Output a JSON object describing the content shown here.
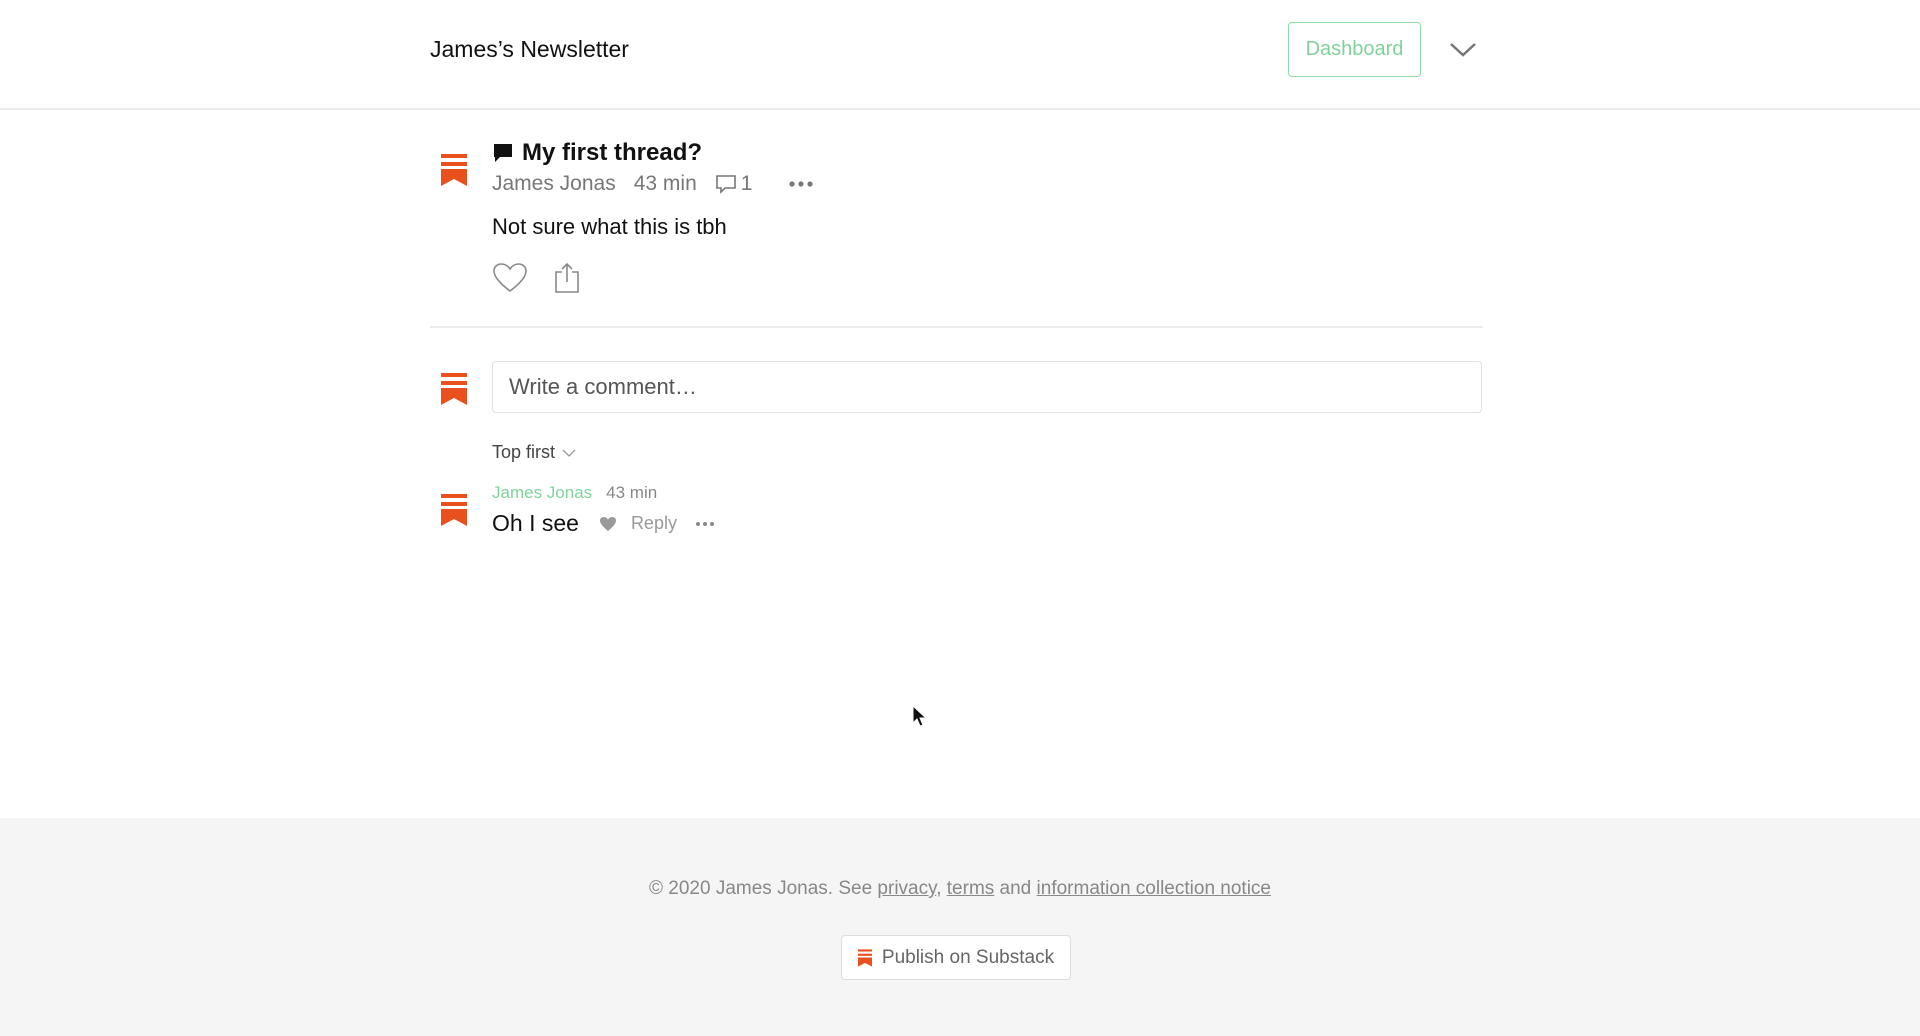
{
  "header": {
    "site_title": "James’s Newsletter",
    "dashboard_label": "Dashboard"
  },
  "post": {
    "title": "My first thread?",
    "author": "James Jonas",
    "time": "43 min",
    "comment_count": "1",
    "body": "Not sure what this is tbh"
  },
  "comment_box": {
    "placeholder": "Write a comment…"
  },
  "sort": {
    "selected": "Top first"
  },
  "comments": [
    {
      "author": "James Jonas",
      "time": "43 min",
      "body": "Oh I see",
      "reply_label": "Reply"
    }
  ],
  "footer": {
    "copyright_prefix": "© 2020 James Jonas. See ",
    "privacy": "privacy",
    "sep": ", ",
    "terms": "terms",
    "and": " and ",
    "notice": "information collection notice",
    "publish_label": "Publish on Substack"
  },
  "colors": {
    "accent_green": "#7fd39a",
    "brand_orange": "#e8501e"
  }
}
